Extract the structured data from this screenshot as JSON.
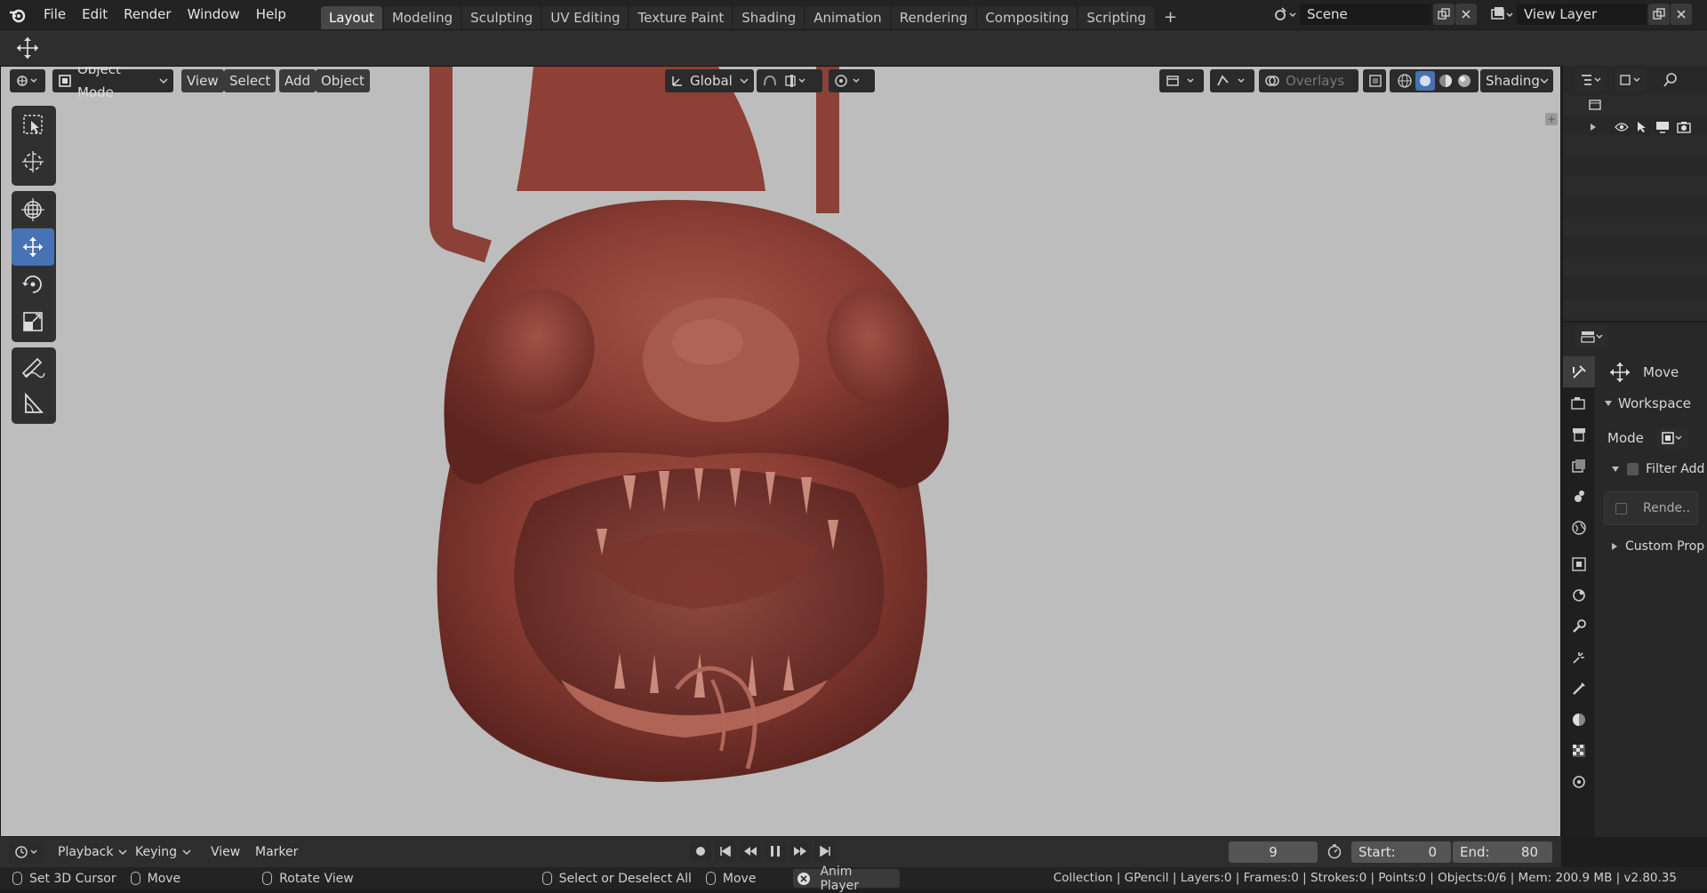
{
  "menu": [
    "File",
    "Edit",
    "Render",
    "Window",
    "Help"
  ],
  "workspace_tabs": [
    "Layout",
    "Modeling",
    "Sculpting",
    "UV Editing",
    "Texture Paint",
    "Shading",
    "Animation",
    "Rendering",
    "Compositing",
    "Scripting"
  ],
  "active_tab": "Layout",
  "scene": {
    "name": "Scene"
  },
  "view_layer": {
    "name": "View Layer"
  },
  "viewport": {
    "mode": "Object Mode",
    "menus": [
      "View",
      "Select",
      "Add",
      "Object"
    ],
    "orientation": "Global",
    "overlays_label": "Overlays",
    "shading_label": "Shading"
  },
  "properties": {
    "active_tool_label": "Move",
    "workspace_panel": "Workspace",
    "mode_label": "Mode",
    "filter_addons": "Filter Add-",
    "render_label": "Rende..",
    "custom_props": "Custom Prope"
  },
  "timeline": {
    "menus": [
      "Playback",
      "Keying",
      "View",
      "Marker"
    ],
    "current_frame": "9",
    "start_label": "Start:",
    "start": "0",
    "end_label": "End:",
    "end": "80"
  },
  "status": {
    "set_cursor": "Set 3D Cursor",
    "move": "Move",
    "rotate_view": "Rotate View",
    "select": "Select or Deselect All",
    "move2": "Move",
    "anim_player": "Anim Player",
    "stats": "Collection | GPencil | Layers:0 | Frames:0 | Strokes:0 | Points:0 | Objects:0/6 | Mem: 200.9 MB | v2.80.35"
  },
  "colors": {
    "accent": "#4772b3",
    "viewport_bg": "#bdbdbd",
    "creature": "#8a3d33"
  }
}
